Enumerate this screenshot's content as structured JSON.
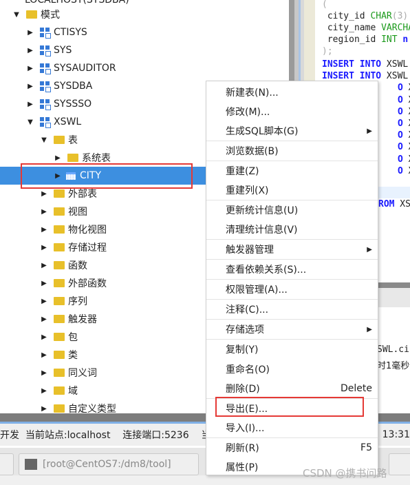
{
  "tree": {
    "top_partial": "LOCALHOST(SYSDBA)",
    "items": [
      {
        "label": "模式",
        "icon": "folder-open-icon",
        "expanded": true
      },
      {
        "label": "CTISYS",
        "icon": "schema-icon"
      },
      {
        "label": "SYS",
        "icon": "schema-icon"
      },
      {
        "label": "SYSAUDITOR",
        "icon": "schema-icon"
      },
      {
        "label": "SYSDBA",
        "icon": "schema-icon"
      },
      {
        "label": "SYSSSO",
        "icon": "schema-icon"
      },
      {
        "label": "XSWL",
        "icon": "schema-icon",
        "expanded": true
      },
      {
        "label": "表",
        "icon": "folder-open-icon",
        "expanded": true
      },
      {
        "label": "系统表",
        "icon": "folder-icon"
      },
      {
        "label": "CITY",
        "icon": "table-icon",
        "selected": true
      },
      {
        "label": "外部表",
        "icon": "folder-icon"
      },
      {
        "label": "视图",
        "icon": "folder-icon"
      },
      {
        "label": "物化视图",
        "icon": "folder-icon"
      },
      {
        "label": "存储过程",
        "icon": "folder-icon"
      },
      {
        "label": "函数",
        "icon": "folder-icon"
      },
      {
        "label": "外部函数",
        "icon": "folder-icon"
      },
      {
        "label": "序列",
        "icon": "folder-icon"
      },
      {
        "label": "触发器",
        "icon": "folder-icon"
      },
      {
        "label": "包",
        "icon": "folder-icon"
      },
      {
        "label": "类",
        "icon": "folder-icon"
      },
      {
        "label": "同义词",
        "icon": "folder-icon"
      },
      {
        "label": "域",
        "icon": "folder-icon"
      },
      {
        "label": "自定义类型",
        "icon": "folder-icon"
      }
    ]
  },
  "editor": {
    "lines": [
      {
        "a": "(",
        "b": "",
        "c": ""
      },
      {
        "a": " city_id ",
        "b": "CHAR",
        "c": "(3)"
      },
      {
        "a": " city_name ",
        "b": "VARCHAR",
        "c": ""
      },
      {
        "a": " region_id ",
        "b": "INT",
        "c": " n"
      },
      {
        "a": ");",
        "b": "",
        "c": ""
      }
    ],
    "insert_kw": "INSERT INTO",
    "insert_tail": " XSWL",
    "insert_partial": "O",
    "from_partial": "ROM",
    "from_tail": " XS"
  },
  "output": {
    "line1": "SWL.ci",
    "line2": "时1毫秒"
  },
  "context_menu": {
    "items": [
      {
        "label": "新建表(N)..."
      },
      {
        "label": "修改(M)..."
      },
      {
        "label": "生成SQL脚本(G)",
        "submenu": true
      },
      {
        "label": "浏览数据(B)"
      },
      {
        "label": "重建(Z)"
      },
      {
        "label": "重建列(X)"
      },
      {
        "label": "更新统计信息(U)"
      },
      {
        "label": "清理统计信息(V)"
      },
      {
        "label": "触发器管理",
        "submenu": true
      },
      {
        "label": "查看依赖关系(S)..."
      },
      {
        "label": "权限管理(A)..."
      },
      {
        "label": "注释(C)..."
      },
      {
        "label": "存储选项",
        "submenu": true
      },
      {
        "label": "复制(Y)"
      },
      {
        "label": "重命名(O)"
      },
      {
        "label": "删除(D)",
        "shortcut": "Delete"
      },
      {
        "label": "导出(E)...",
        "highlighted": true
      },
      {
        "label": "导入(I)..."
      },
      {
        "label": "刷新(R)",
        "shortcut": "F5"
      },
      {
        "label": "属性(P)"
      }
    ]
  },
  "status": {
    "mode": "开发",
    "site": "当前站点:localhost",
    "port": "连接端口:5236",
    "partial": "当",
    "time": "13 13:31"
  },
  "taskbar": {
    "terminal": "[root@CentOS7:/dm8/tool]"
  },
  "watermark": "CSDN @携书问路",
  "colors": {
    "selection": "#3d8fe0",
    "highlight_box": "#e53935",
    "keyword": "#1a1aff",
    "type": "#1c9a1c"
  }
}
